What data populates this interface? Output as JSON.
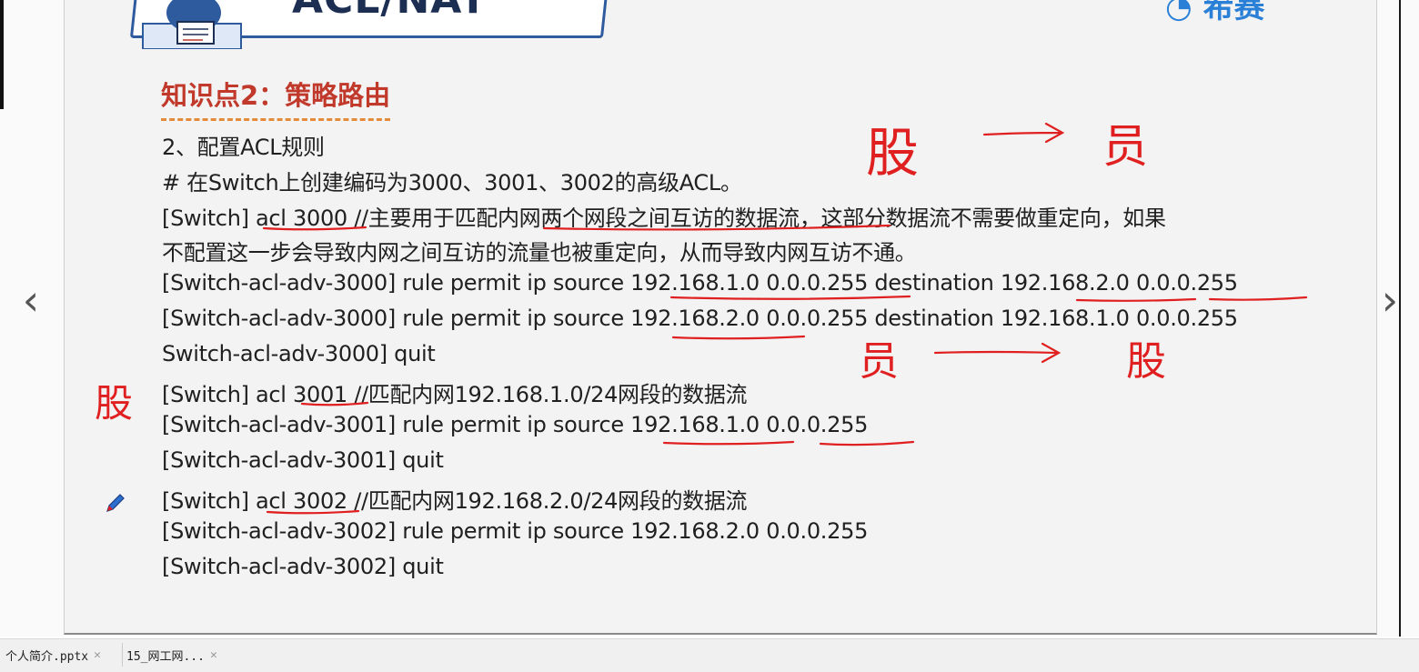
{
  "slide": {
    "header_title": "ACL/NAT",
    "brand_text": "希赛",
    "section_title": "知识点2：策略路由",
    "lines": [
      "2、配置ACL规则",
      "# 在Switch上创建编码为3000、3001、3002的高级ACL。",
      "[Switch] acl 3000  //主要用于匹配内网两个网段之间互访的数据流，这部分数据流不需要做重定向，如果",
      "不配置这一步会导致内网之间互访的流量也被重定向，从而导致内网互访不通。",
      "[Switch-acl-adv-3000] rule permit ip source 192.168.1.0 0.0.0.255 destination 192.168.2.0 0.0.0.255",
      "[Switch-acl-adv-3000] rule permit ip source 192.168.2.0 0.0.0.255 destination 192.168.1.0 0.0.0.255",
      "Switch-acl-adv-3000] quit",
      "[Switch] acl 3001  //匹配内网192.168.1.0/24网段的数据流",
      "[Switch-acl-adv-3001] rule permit ip source 192.168.1.0 0.0.0.255",
      "[Switch-acl-adv-3001] quit",
      "[Switch] acl 3002  //匹配内网192.168.2.0/24网段的数据流",
      "[Switch-acl-adv-3002] rule permit ip source 192.168.2.0 0.0.0.255",
      "[Switch-acl-adv-3002] quit"
    ]
  },
  "handwriting": {
    "top_left": "股",
    "top_right": "员",
    "mid_left": "员",
    "mid_right": "股",
    "margin": "股"
  },
  "tabs": [
    {
      "label": "个人简介.pptx"
    },
    {
      "label": "15_网工网..."
    }
  ],
  "colors": {
    "section_title": "#c0392b",
    "ink_red": "#e02020",
    "brand": "#2a7fd6"
  },
  "icons": {
    "prev": "chevron-left-icon",
    "next": "chevron-right-icon",
    "pen": "pen-icon",
    "close": "close-icon"
  }
}
